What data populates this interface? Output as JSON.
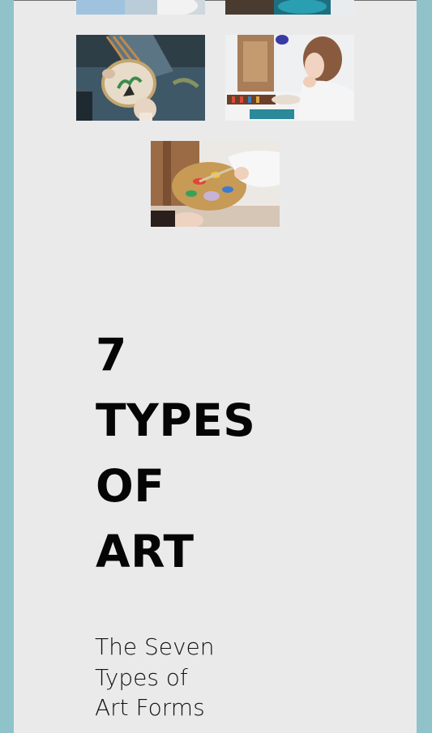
{
  "gallery": {
    "images": [
      {
        "name": "art-photo-top-left-cropped"
      },
      {
        "name": "art-photo-top-right-cropped"
      },
      {
        "name": "art-photo-embroidery"
      },
      {
        "name": "art-photo-woman-painting"
      },
      {
        "name": "art-photo-palette"
      }
    ]
  },
  "hero": {
    "title_lines": [
      "7",
      "TYPES",
      "OF",
      "ART"
    ],
    "subtitle_lines": [
      "The Seven",
      "Types of",
      "Art Forms"
    ]
  }
}
